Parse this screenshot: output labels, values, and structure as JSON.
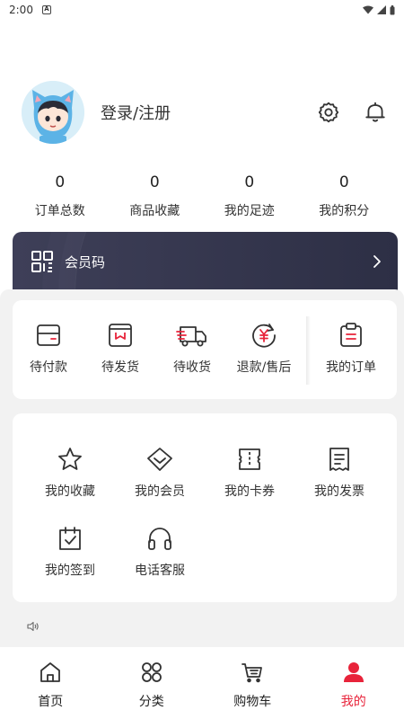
{
  "status_bar": {
    "time": "2:00",
    "notif_letter": "A"
  },
  "profile": {
    "login_label": "登录/注册"
  },
  "stats": [
    {
      "value": "0",
      "label": "订单总数"
    },
    {
      "value": "0",
      "label": "商品收藏"
    },
    {
      "value": "0",
      "label": "我的足迹"
    },
    {
      "value": "0",
      "label": "我的积分"
    }
  ],
  "member": {
    "label": "会员码"
  },
  "orders": [
    {
      "label": "待付款",
      "icon": "wallet-card-icon"
    },
    {
      "label": "待发货",
      "icon": "package-box-icon"
    },
    {
      "label": "待收货",
      "icon": "delivery-truck-icon"
    },
    {
      "label": "退款/售后",
      "icon": "yuan-refund-icon"
    },
    {
      "label": "我的订单",
      "icon": "clipboard-icon"
    }
  ],
  "services": [
    {
      "label": "我的收藏",
      "icon": "star-icon"
    },
    {
      "label": "我的会员",
      "icon": "diamond-icon"
    },
    {
      "label": "我的卡券",
      "icon": "ticket-icon"
    },
    {
      "label": "我的发票",
      "icon": "receipt-icon"
    },
    {
      "label": "我的签到",
      "icon": "calendar-check-icon"
    },
    {
      "label": "电话客服",
      "icon": "headset-icon"
    }
  ],
  "tabs": [
    {
      "label": "首页",
      "icon": "home-icon"
    },
    {
      "label": "分类",
      "icon": "grid-icon"
    },
    {
      "label": "购物车",
      "icon": "cart-icon"
    },
    {
      "label": "我的",
      "icon": "user-icon",
      "active": true
    }
  ],
  "colors": {
    "accent": "#e8233a",
    "member_card": "#3a3b54",
    "background": "#f2f2f2"
  }
}
